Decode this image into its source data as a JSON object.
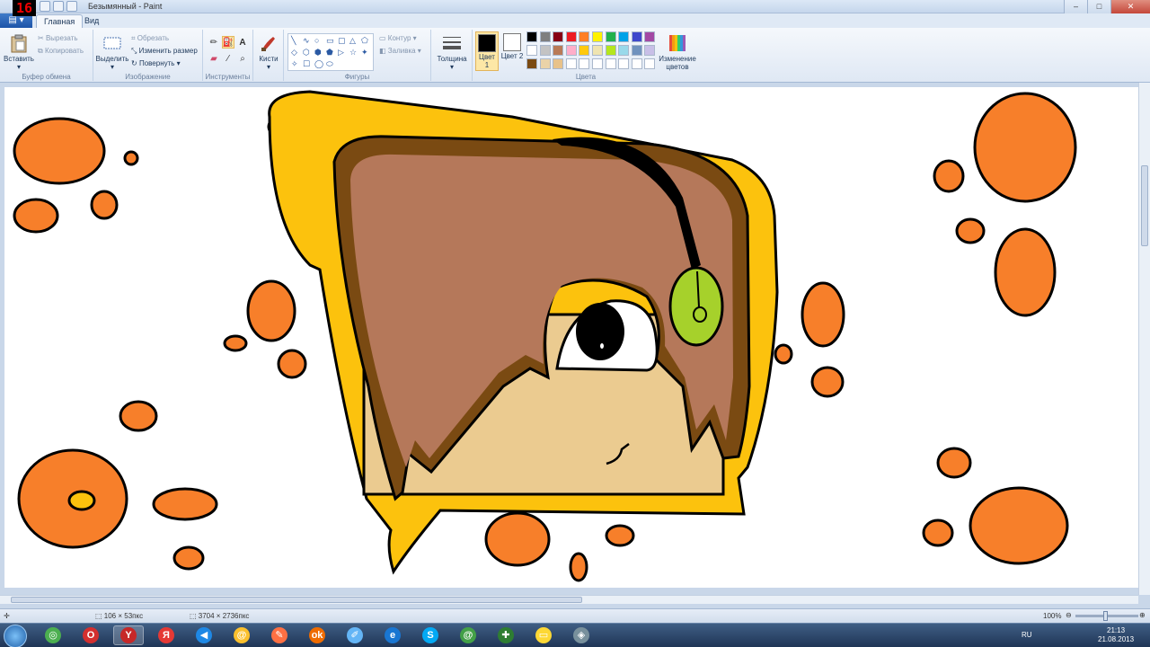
{
  "recorder": {
    "counter": "16"
  },
  "window": {
    "title": "Безымянный - Paint",
    "controls": {
      "minimize": "–",
      "maximize": "□",
      "close": "✕"
    }
  },
  "ribbon": {
    "file_menu": "▤ ▾",
    "tabs": [
      {
        "label": "Главная",
        "active": true
      },
      {
        "label": "Вид",
        "active": false
      }
    ],
    "clipboard": {
      "label": "Буфер обмена",
      "paste": "Вставить",
      "cut": "Вырезать",
      "copy": "Копировать"
    },
    "image": {
      "label": "Изображение",
      "select": "Выделить",
      "crop": "Обрезать",
      "resize": "Изменить размер",
      "rotate": "Повернуть"
    },
    "tools": {
      "label": "Инструменты",
      "text_tool": "A"
    },
    "brushes": {
      "label": "Кисти"
    },
    "shapes": {
      "label": "Фигуры",
      "outline": "Контур",
      "fill": "Заливка",
      "glyphs": [
        "╲",
        "∿",
        "○",
        "▭",
        "▢",
        "△",
        "⬠",
        "◇",
        "⬡",
        "⬢",
        "⬟",
        "▷",
        "☆",
        "✦",
        "✧",
        "☐",
        "◯",
        "⬭"
      ]
    },
    "thickness": {
      "label": "Толщина"
    },
    "colors": {
      "label": "Цвета",
      "color1_label": "Цвет 1",
      "color2_label": "Цвет 2",
      "color1": "#000000",
      "color2": "#ffffff",
      "edit_colors": "Изменение цветов",
      "palette_row1": [
        "#000000",
        "#7f7f7f",
        "#880015",
        "#ed1c24",
        "#ff7f27",
        "#fff200",
        "#22b14c",
        "#00a2e8",
        "#3f48cc",
        "#a349a4"
      ],
      "palette_row2": [
        "#ffffff",
        "#c3c3c3",
        "#b97a57",
        "#ffaec9",
        "#ffc90e",
        "#efe4b0",
        "#b5e61d",
        "#99d9ea",
        "#7092be",
        "#c8bfe7"
      ],
      "palette_row3": [
        "#7a4a12",
        "#ead3a8",
        "#e8c28a",
        "#ffffff",
        "#ffffff",
        "#ffffff",
        "#ffffff",
        "#ffffff",
        "#ffffff",
        "#ffffff"
      ]
    }
  },
  "drawing_colors": {
    "orange": "#f77f2a",
    "yellow": "#fcc20d",
    "hair": "#b5785a",
    "hair_dark": "#7a4a12",
    "skin": "#ebcb90",
    "headphone": "#a6d12b",
    "outline": "#000000"
  },
  "statusbar": {
    "cursor_icon": "✛",
    "selection_size": "106 × 53пкс",
    "image_size": "3704 × 2736пкс",
    "zoom": "100%",
    "zoom_minus": "⊖",
    "zoom_plus": "⊕"
  },
  "taskbar": {
    "apps": [
      "chrome-icon",
      "opera-icon",
      "yandex-browser-icon",
      "yandex-icon",
      "media-player-icon",
      "mail-agent-icon",
      "paint-icon",
      "odnoklassniki-icon",
      "notepad-icon",
      "internet-explorer-icon",
      "skype-icon",
      "icq-icon",
      "plus-icon",
      "folder-icon",
      "eraser-icon"
    ],
    "app_glyphs": [
      "◎",
      "O",
      "Y",
      "Я",
      "◀",
      "@",
      "✎",
      "ok",
      "✐",
      "e",
      "S",
      "@",
      "✚",
      "▭",
      "◈"
    ],
    "language": "RU",
    "time": "21:13",
    "date": "21.08.2013"
  }
}
